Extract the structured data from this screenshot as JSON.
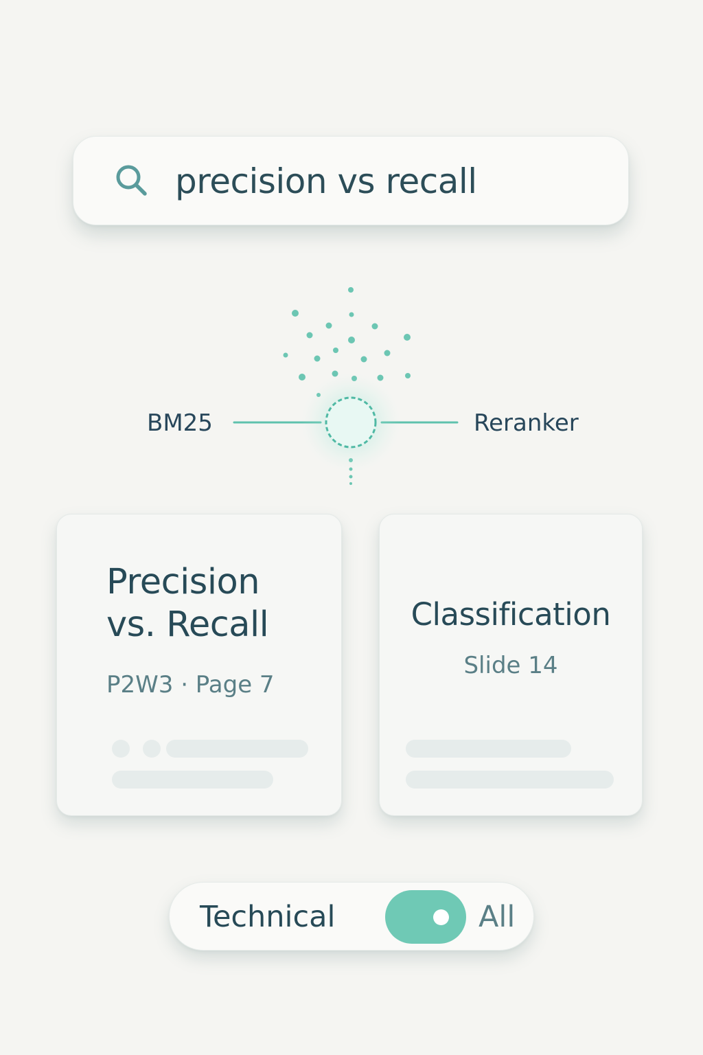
{
  "search": {
    "value": "precision vs recall"
  },
  "fusion": {
    "left_label": "BM25",
    "right_label": "Reranker"
  },
  "results": [
    {
      "title_line1": "Precision",
      "title_line2": "vs. Recall",
      "meta": "P2W3 · Page 7"
    },
    {
      "title": "Classification",
      "meta": "Slide 14"
    }
  ],
  "filter": {
    "left_label": "Technical",
    "right_label": "All",
    "toggle_state": "on"
  },
  "colors": {
    "accent": "#6fc9b5",
    "text_primary": "#274a57",
    "text_secondary": "#5a7f86",
    "background": "#f5f5f2"
  }
}
